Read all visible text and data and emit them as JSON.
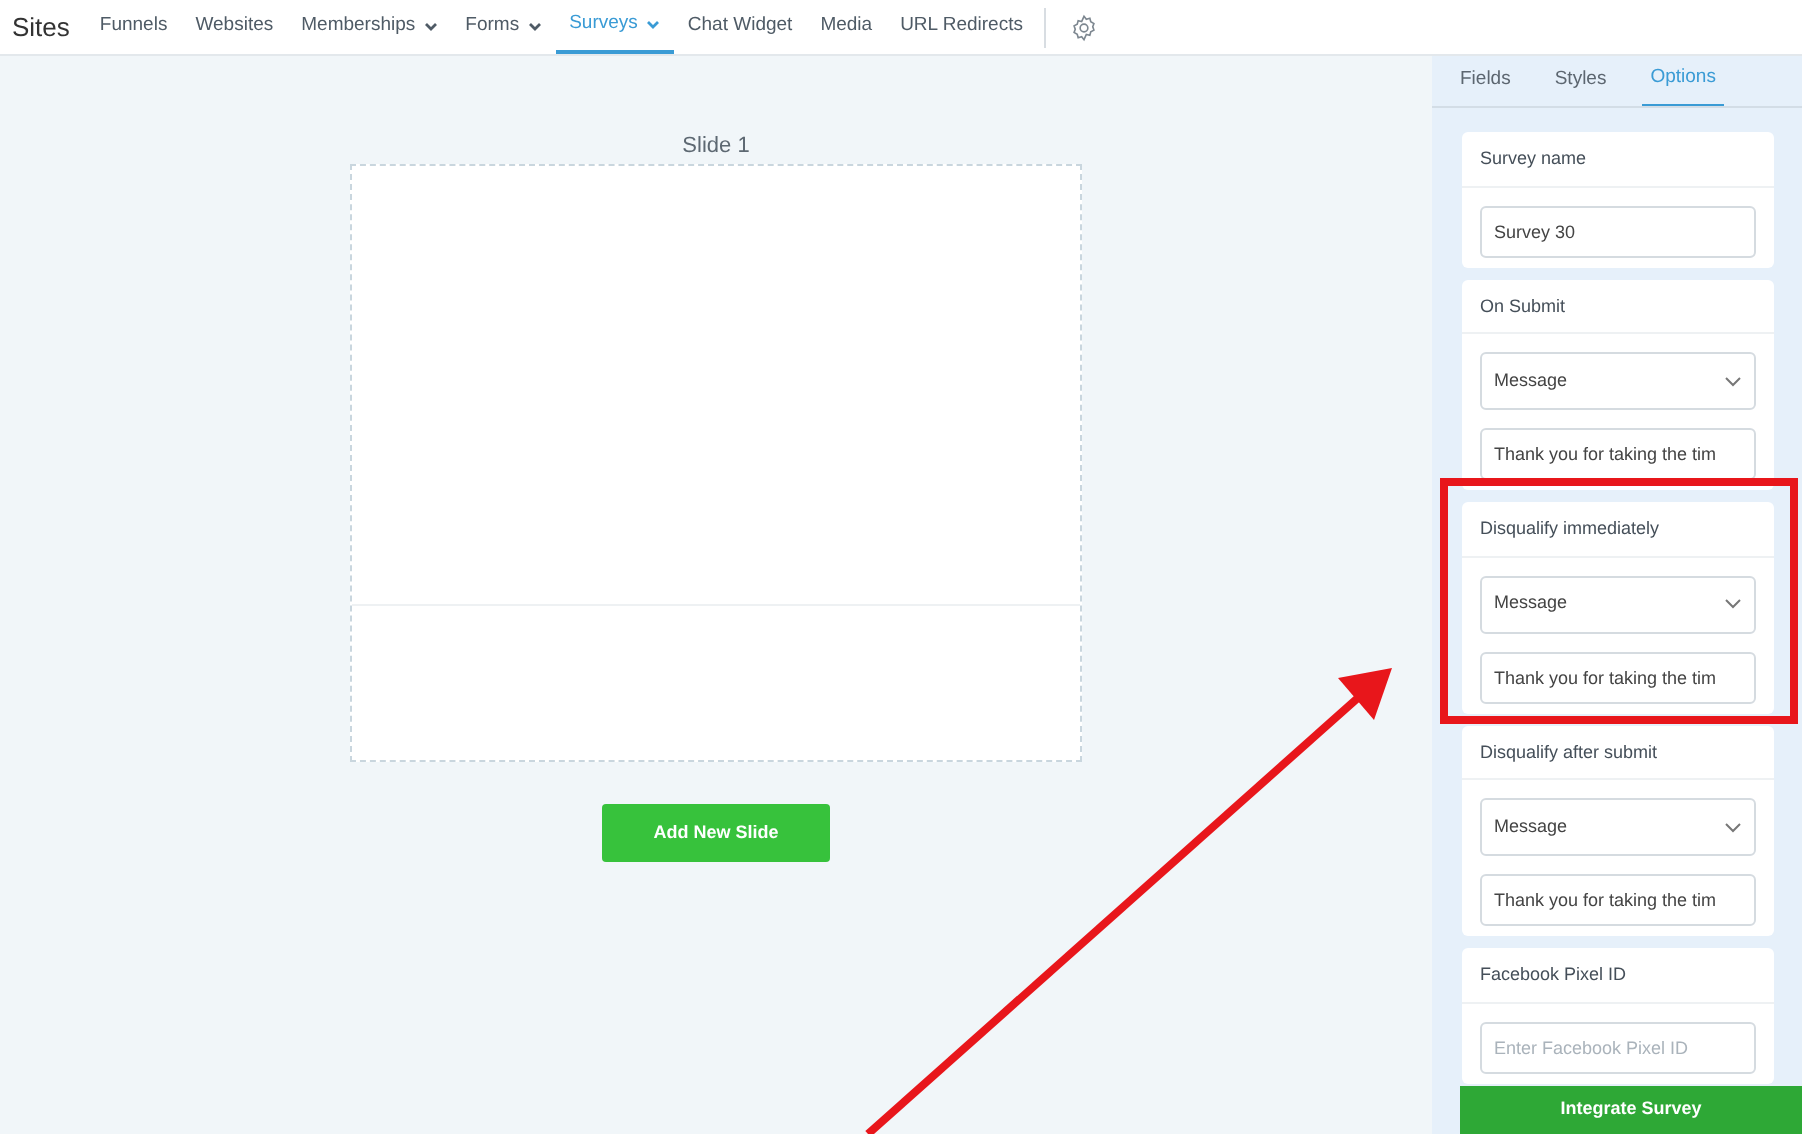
{
  "nav": {
    "brand": "Sites",
    "items": [
      {
        "label": "Funnels",
        "dropdown": false,
        "selected": false
      },
      {
        "label": "Websites",
        "dropdown": false,
        "selected": false
      },
      {
        "label": "Memberships",
        "dropdown": true,
        "selected": false
      },
      {
        "label": "Forms",
        "dropdown": true,
        "selected": false
      },
      {
        "label": "Surveys",
        "dropdown": true,
        "selected": true
      },
      {
        "label": "Chat Widget",
        "dropdown": false,
        "selected": false
      },
      {
        "label": "Media",
        "dropdown": false,
        "selected": false
      },
      {
        "label": "URL Redirects",
        "dropdown": false,
        "selected": false
      }
    ]
  },
  "canvas": {
    "slide_title": "Slide 1",
    "add_button": "Add New Slide"
  },
  "panel": {
    "tabs": [
      {
        "label": "Fields",
        "selected": false
      },
      {
        "label": "Styles",
        "selected": false
      },
      {
        "label": "Options",
        "selected": true
      }
    ],
    "sections": [
      {
        "title": "Survey name",
        "fields": [
          {
            "kind": "text",
            "value": "Survey 30"
          }
        ]
      },
      {
        "title": "On Submit",
        "fields": [
          {
            "kind": "select",
            "value": "Message"
          },
          {
            "kind": "text",
            "value": "Thank you for taking the tim"
          }
        ]
      },
      {
        "title": "Disqualify immediately",
        "fields": [
          {
            "kind": "select",
            "value": "Message"
          },
          {
            "kind": "text",
            "value": "Thank you for taking the tim"
          }
        ]
      },
      {
        "title": "Disqualify after submit",
        "fields": [
          {
            "kind": "select",
            "value": "Message"
          },
          {
            "kind": "text",
            "value": "Thank you for taking the tim"
          }
        ]
      },
      {
        "title": "Facebook Pixel ID",
        "fields": [
          {
            "kind": "text",
            "placeholder": "Enter Facebook Pixel ID"
          }
        ]
      }
    ],
    "integrate_button": "Integrate Survey"
  },
  "annotations": {
    "highlight_box": true,
    "arrow": true
  }
}
